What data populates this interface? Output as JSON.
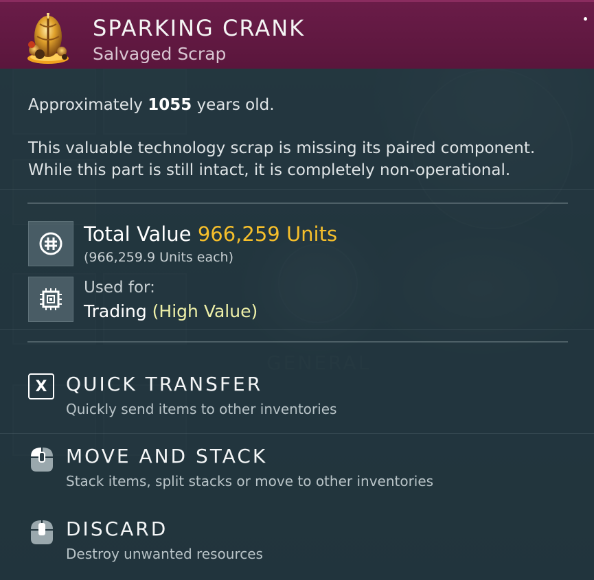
{
  "item": {
    "title": "SPARKING CRANK",
    "subtitle": "Salvaged Scrap",
    "icon": "sparking-crank-icon"
  },
  "description": {
    "age_prefix": "Approximately ",
    "age_value": "1055",
    "age_suffix": " years old.",
    "lines": [
      "This valuable technology scrap is missing its paired component.",
      "While this part is still intact, it is completely non-operational."
    ]
  },
  "value": {
    "label": "Total Value ",
    "amount": "966,259 Units",
    "each": "(966,259.9 Units each)",
    "icon": "units-currency-icon",
    "amount_color": "#f6bf2b"
  },
  "usage": {
    "label": "Used for:",
    "value": "Trading ",
    "highlight": "(High Value)",
    "icon": "chip-icon",
    "highlight_color": "#eef0a8"
  },
  "actions": [
    {
      "title": "QUICK TRANSFER",
      "desc": "Quickly send items to other inventories",
      "key": "X",
      "icon": "x-key-icon"
    },
    {
      "title": "MOVE AND STACK",
      "desc": "Stack items, split stacks or move to other inventories",
      "icon": "mouse-left-click-icon"
    },
    {
      "title": "DISCARD",
      "desc": "Destroy unwanted resources",
      "icon": "mouse-middle-click-icon"
    }
  ],
  "colors": {
    "header": "#6a1c48",
    "panel": "#21343d",
    "gold": "#f6bf2b"
  }
}
